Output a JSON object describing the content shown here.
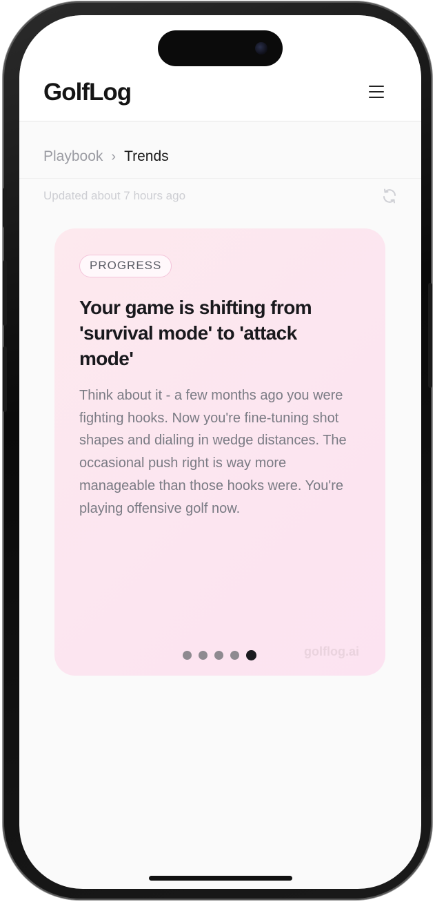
{
  "app": {
    "name": "GolfLog"
  },
  "breadcrumb": {
    "parent": "Playbook",
    "separator": "›",
    "current": "Trends"
  },
  "status": {
    "updated_text": "Updated about 7 hours ago"
  },
  "card": {
    "tag": "PROGRESS",
    "title": "Your game is shifting from 'survival mode' to 'attack mode'",
    "body": "Think about it - a few months ago you were fighting hooks. Now you're fine-tuning shot shapes and dialing in wedge distances. The occasional push right is way more manageable than those hooks were. You're playing offensive golf now.",
    "watermark": "golflog.ai",
    "pagination": {
      "total": 5,
      "current": 5
    }
  },
  "colors": {
    "card_bg": "#fce5f0",
    "tag_border": "#f3c3d9",
    "title": "#19191d",
    "body_text": "#7a7b84",
    "dot_inactive": "#8e8a90",
    "dot_active": "#1b1b1f"
  },
  "icons": {
    "menu": "hamburger-menu-icon",
    "refresh": "refresh-icon"
  }
}
